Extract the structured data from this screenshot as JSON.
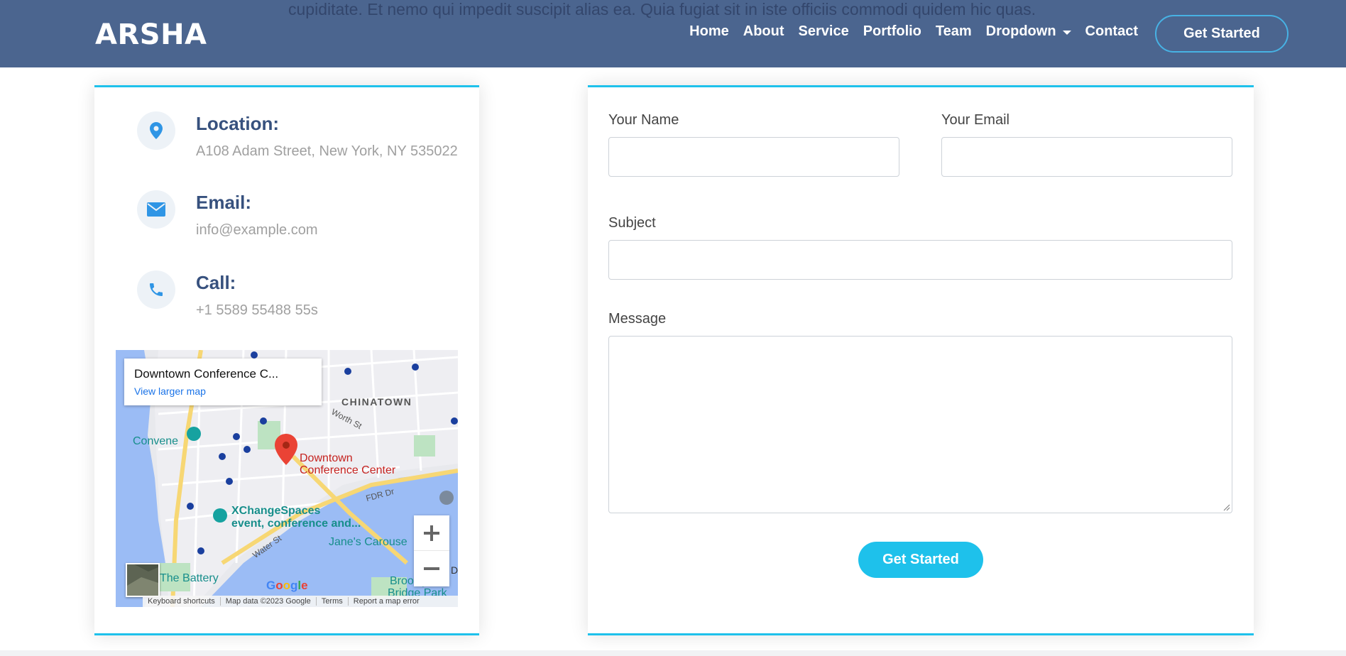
{
  "header": {
    "logo": "ARSHA",
    "background_text": "cupiditate. Et nemo qui impedit suscipit alias ea. Quia fugiat sit in iste officiis commodi quidem hic quas.",
    "nav": [
      {
        "label": "Home"
      },
      {
        "label": "About"
      },
      {
        "label": "Service"
      },
      {
        "label": "Portfolio"
      },
      {
        "label": "Team"
      },
      {
        "label": "Dropdown",
        "has_caret": true
      },
      {
        "label": "Contact"
      }
    ],
    "cta": "Get Started"
  },
  "info": {
    "location": {
      "title": "Location:",
      "text": "A108 Adam Street, New York, NY 535022",
      "icon": "map-pin-icon"
    },
    "email": {
      "title": "Email:",
      "text": "info@example.com",
      "icon": "envelope-icon"
    },
    "call": {
      "title": "Call:",
      "text": "+1 5589 55488 55s",
      "icon": "phone-icon"
    }
  },
  "map": {
    "place_title": "Downtown Conference C...",
    "view_larger": "View larger map",
    "pin_label_line1": "Downtown",
    "pin_label_line2": "Conference Center",
    "labels": {
      "chinatown": "CHINATOWN",
      "convene": "Convene",
      "xchange1": "XChangeSpaces",
      "xchange2": "event, conference and...",
      "janes": "Jane's Carouse",
      "battery": "The Battery",
      "brooklyn1": "Brooklyn",
      "brooklyn2": "Bridge Park",
      "worth": "Worth St",
      "water": "Water St",
      "fdr": "FDR Dr",
      "edge_d": "D"
    },
    "google": "Google",
    "footer": {
      "keyboard": "Keyboard shortcuts",
      "data": "Map data ©2023 Google",
      "terms": "Terms",
      "report": "Report a map error"
    }
  },
  "form": {
    "name_label": "Your Name",
    "name_value": "",
    "email_label": "Your Email",
    "email_value": "",
    "subject_label": "Subject",
    "subject_value": "",
    "message_label": "Message",
    "message_value": "",
    "submit": "Get Started"
  },
  "colors": {
    "header_bg": "#4b658f",
    "accent": "#1ec1eb",
    "heading": "#37517e",
    "icon_blue": "#2f95e5"
  }
}
